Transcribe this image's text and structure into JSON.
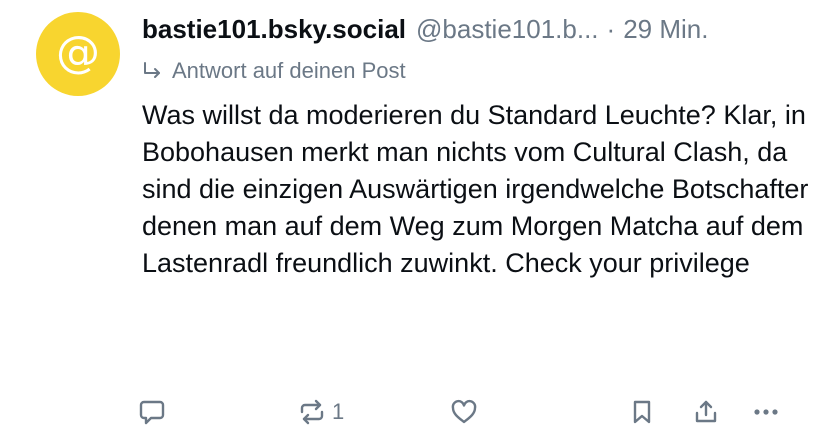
{
  "post": {
    "avatar_glyph": "@",
    "author_display_name": "bastie101.bsky.social",
    "author_handle": "@bastie101.b...",
    "separator": "·",
    "timestamp": "29 Min.",
    "reply_context": "Antwort auf deinen Post",
    "text": "Was willst da moderieren du Standard Leuchte? Klar, in Bobohausen merkt man nichts vom Cultural Clash, da sind die einzigen Auswärtigen irgendwelche Botschafter denen man auf dem Weg zum Morgen Matcha auf dem Lastenradl freundlich zuwinkt. Check your privilege"
  },
  "actions": {
    "reply_icon": "speech-bubble-icon",
    "repost_icon": "repost-icon",
    "repost_count": "1",
    "like_icon": "heart-icon",
    "bookmark_icon": "bookmark-icon",
    "share_icon": "share-icon",
    "more_icon": "ellipsis-icon"
  },
  "colors": {
    "avatar_bg": "#f8d52f",
    "muted_text": "#6b7886",
    "primary_text": "#0b0f14"
  }
}
